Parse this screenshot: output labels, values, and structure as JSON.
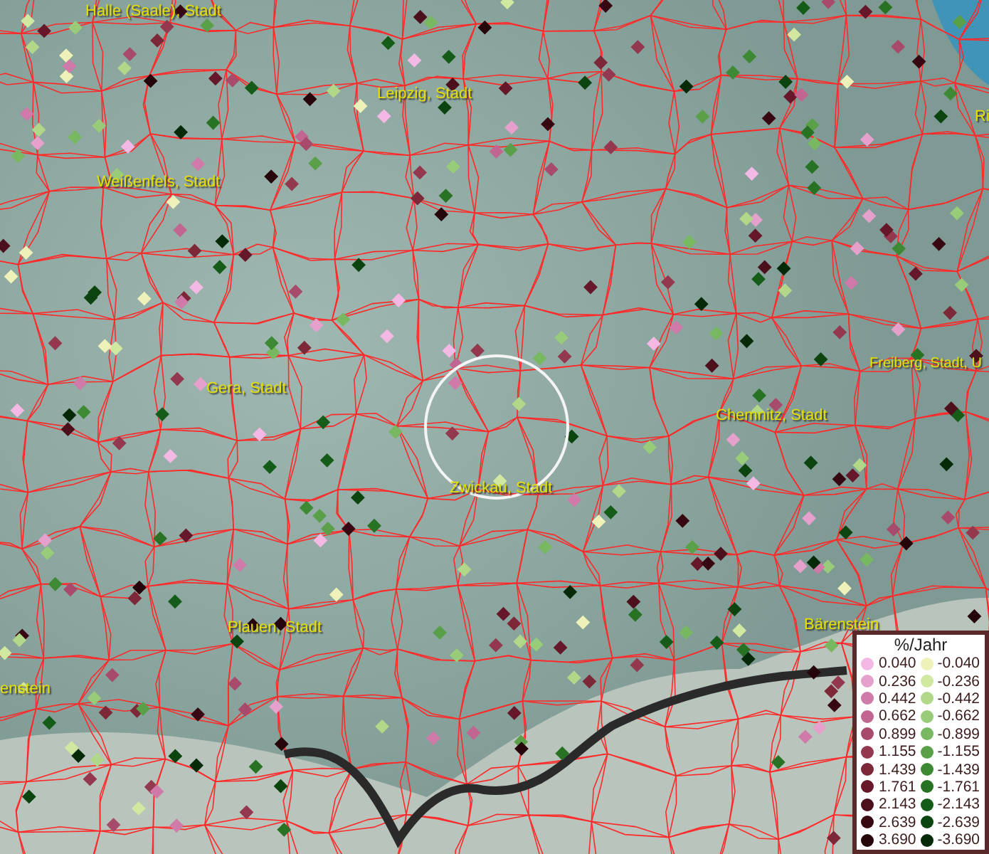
{
  "map": {
    "labels": [
      {
        "text": "Halle (Saale), Stadt"
      },
      {
        "text": "Leipzig, Stadt"
      },
      {
        "text": "Weißenfels, Stadt"
      },
      {
        "text": "Gera, Stadt"
      },
      {
        "text": "Chemnitz, Stadt"
      },
      {
        "text": "Freiberg, Stadt, U"
      },
      {
        "text": "Zwickau, Stadt"
      },
      {
        "text": "Plauen, Stadt"
      },
      {
        "text": "Bärenstein"
      },
      {
        "text": "enstein"
      },
      {
        "text": "Ri"
      }
    ]
  },
  "legend": {
    "title": "%/Jahr",
    "columns": [
      [
        {
          "value": "0.040",
          "color": "#f4b8e4"
        },
        {
          "value": "0.236",
          "color": "#e6a0cc"
        },
        {
          "value": "0.442",
          "color": "#cf7aa8"
        },
        {
          "value": "0.662",
          "color": "#c06690"
        },
        {
          "value": "0.899",
          "color": "#a84a6c"
        },
        {
          "value": "1.155",
          "color": "#93384f"
        },
        {
          "value": "1.439",
          "color": "#7d2838"
        },
        {
          "value": "1.761",
          "color": "#66182a"
        },
        {
          "value": "2.143",
          "color": "#4c0f1c"
        },
        {
          "value": "2.639",
          "color": "#380812"
        },
        {
          "value": "3.690",
          "color": "#250509"
        }
      ],
      [
        {
          "value": "-0.040",
          "color": "#eef2b8"
        },
        {
          "value": "-0.236",
          "color": "#d0e8a0"
        },
        {
          "value": "-0.442",
          "color": "#b0d888"
        },
        {
          "value": "-0.662",
          "color": "#98cc78"
        },
        {
          "value": "-0.899",
          "color": "#78b860"
        },
        {
          "value": "-1.155",
          "color": "#5aa048"
        },
        {
          "value": "-1.439",
          "color": "#3e8a34"
        },
        {
          "value": "-1.761",
          "color": "#287224"
        },
        {
          "value": "-2.143",
          "color": "#155c18"
        },
        {
          "value": "-2.639",
          "color": "#0c4410"
        },
        {
          "value": "-3.690",
          "color": "#062a08"
        }
      ]
    ]
  }
}
